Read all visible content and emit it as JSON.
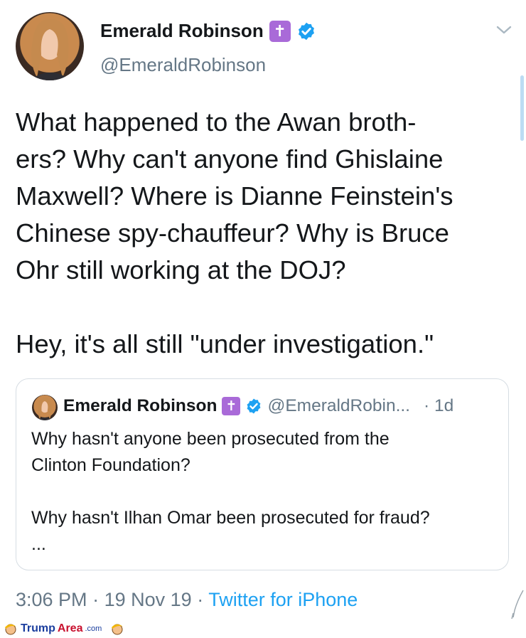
{
  "tweet": {
    "author_name": "Emerald Robinson",
    "author_handle": "@EmeraldRobinson",
    "name_emoji": "✝",
    "text": "What happened to the Awan broth-\ners? Why can't anyone find Ghislaine\nMaxwell? Where is Dianne Feinstein's\nChinese spy-chauffeur? Why is Bruce\nOhr still working at the DOJ?\n\nHey, it's all still \"under investigation.\"",
    "time": "3:06 PM",
    "date": "19 Nov 19",
    "source": "Twitter for iPhone",
    "separator": "·"
  },
  "quoted": {
    "author_name": "Emerald Robinson",
    "author_handle": "@EmeraldRobin...",
    "name_emoji": "✝",
    "age": "· 1d",
    "text": "Why hasn't anyone been prosecuted from the\nClinton Foundation?\n\nWhy hasn't Ilhan Omar been prosecuted for fraud?\n..."
  },
  "watermark": {
    "part1": "Trump",
    "part2": "Area",
    "part3": ".com"
  },
  "colors": {
    "link_blue": "#1da1f2",
    "secondary_gray": "#657786",
    "emoji_purple": "#a96ad8",
    "border": "#d6dde3"
  },
  "icons": [
    "avatar",
    "latin-cross-emoji",
    "verified-badge-icon",
    "chevron-down-icon",
    "quill-icon",
    "trump-face-icon"
  ]
}
